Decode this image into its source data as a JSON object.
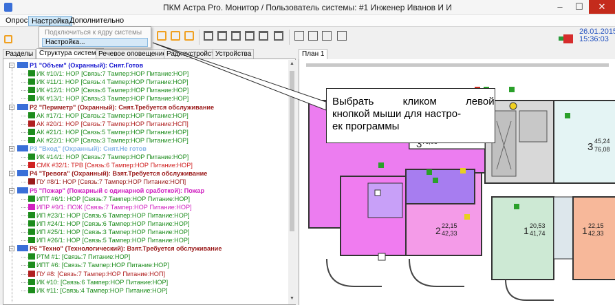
{
  "window": {
    "title": "ПКМ Астра Pro. Монитор / Пользователь системы: #1 Инженер Иванов И И",
    "btn_min": "–",
    "btn_max": "☐",
    "btn_close": "✕"
  },
  "menu": {
    "items": [
      "Опрос",
      "Настройка",
      "Дополнительно"
    ]
  },
  "dropdown": {
    "items": [
      "Подключиться к ядру системы",
      "Настройка..."
    ]
  },
  "status": {
    "date": "26.01.2015",
    "time": "15:36:03"
  },
  "tabs": [
    "Разделы",
    "Структура системы",
    "Речевое оповещение",
    "Радиоустройства",
    "Устройства"
  ],
  "plan": {
    "tab": "План 1"
  },
  "callout": {
    "line1": "Выбрать кликом левой",
    "line2": "кнопкой мыши для настро-",
    "line3": "ек программы"
  },
  "colors": {
    "guard": "#1a1ad0",
    "fire": "#d020c0",
    "ok": "#1c8c1c",
    "trouble": "#b02020",
    "disarmed_grey": "#8ab8e8",
    "tech": "#9a1a1a"
  },
  "tree": [
    {
      "text": "P1 \"Объем\" (Охранный): Снят.Готов",
      "color": "#1a1ad0",
      "group": true
    },
    {
      "text": "ИК #10/1: НОР [Связь:7 Тампер:НОР Питание:НОР]",
      "color": "#1c8c1c"
    },
    {
      "text": "ИК #11/1: НОР [Связь:4 Тампер:НОР Питание:НОР]",
      "color": "#1c8c1c"
    },
    {
      "text": "ИК #12/1: НОР [Связь:6 Тампер:НОР Питание:НОР]",
      "color": "#1c8c1c"
    },
    {
      "text": "ИК #13/1: НОР [Связь:3 Тампер:НОР Питание:НОР]",
      "color": "#1c8c1c"
    },
    {
      "text": "P2 \"Периметр\" (Охранный): Снят.Требуется обслуживание",
      "color": "#9a1a1a",
      "group": true
    },
    {
      "text": "АК #17/1: НОР [Связь:2 Тампер:НОР Питание:НОР]",
      "color": "#1c8c1c"
    },
    {
      "text": "АК #20/1: НОР [Связь:7 Тампер:НОР Питание:НСП]",
      "color": "#b02020"
    },
    {
      "text": "АК #21/1: НОР [Связь:5 Тампер:НОР Питание:НОР]",
      "color": "#1c8c1c"
    },
    {
      "text": "АК #22/1: НОР [Связь:3 Тампер:НОР Питание:НОР]",
      "color": "#1c8c1c"
    },
    {
      "text": "P3 \"Вход\" (Охранный): Снят.Не готов",
      "color": "#8ab8e8",
      "group": true
    },
    {
      "text": "ИК #14/1: НОР [Связь:7 Тампер:НОР Питание:НОР]",
      "color": "#1c8c1c"
    },
    {
      "text": "СМК #32/1: ТРВ [Связь:6 Тампер:НОР Питание:НОР]",
      "color": "#d02020"
    },
    {
      "text": "P4 \"Тревога\" (Охранный): Взят.Требуется обслуживание",
      "color": "#9a1a1a",
      "group": true
    },
    {
      "text": "ПУ #8/1: НОР [Связь:7 Тампер:НОР Питание:НОП]",
      "color": "#9a1a1a"
    },
    {
      "text": "P5 \"Пожар\" (Пожарный с одинарной сработкой): Пожар",
      "color": "#d020c0",
      "group": true
    },
    {
      "text": "ИПТ #6/1: НОР [Связь:7 Тампер:НОР Питание:НОР]",
      "color": "#1c8c1c"
    },
    {
      "text": "ИПР #9/1: ПОЖ [Связь:7 Тампер:НОР Питание:НОР]",
      "color": "#d020c0"
    },
    {
      "text": "ИП #23/1: НОР [Связь:6 Тампер:НОР Питание:НОР]",
      "color": "#1c8c1c"
    },
    {
      "text": "ИП #24/1: НОР [Связь:6 Тампер:НОР Питание:НОР]",
      "color": "#1c8c1c"
    },
    {
      "text": "ИП #25/1: НОР [Связь:3 Тампер:НОР Питание:НОР]",
      "color": "#1c8c1c"
    },
    {
      "text": "ИП #26/1: НОР [Связь:5 Тампер:НОР Питание:НОР]",
      "color": "#1c8c1c"
    },
    {
      "text": "P6 \"Техно\" (Технологический): Взят.Требуется обслуживание",
      "color": "#9a1a1a",
      "group": true
    },
    {
      "text": "РТМ #1: [Связь:7 Питание:НОР]",
      "color": "#1c8c1c"
    },
    {
      "text": "ИПТ #6: [Связь:7 Тампер:НОР Питание:НОР]",
      "color": "#1c8c1c"
    },
    {
      "text": "ПУ #8: [Связь:7 Тампер:НОР Питание:НОП]",
      "color": "#b02020"
    },
    {
      "text": "ИК #10: [Связь:6 Тампер:НОР Питание:НОР]",
      "color": "#1c8c1c"
    },
    {
      "text": "ИК #11: [Связь:4 Тампер:НОР Питание:НОР]",
      "color": "#1c8c1c"
    }
  ],
  "floor": {
    "rooms": [
      {
        "big": "3",
        "sup": "76,08"
      },
      {
        "big": "3",
        "sup": "45,24",
        "sub": "76,08"
      },
      {
        "big": "2",
        "sup": "22,15",
        "sub": "42,33"
      },
      {
        "big": "1",
        "sup": "20,53",
        "sub": "41,74"
      },
      {
        "big": "1",
        "sup": "22,15",
        "sub": "42,33"
      }
    ]
  }
}
